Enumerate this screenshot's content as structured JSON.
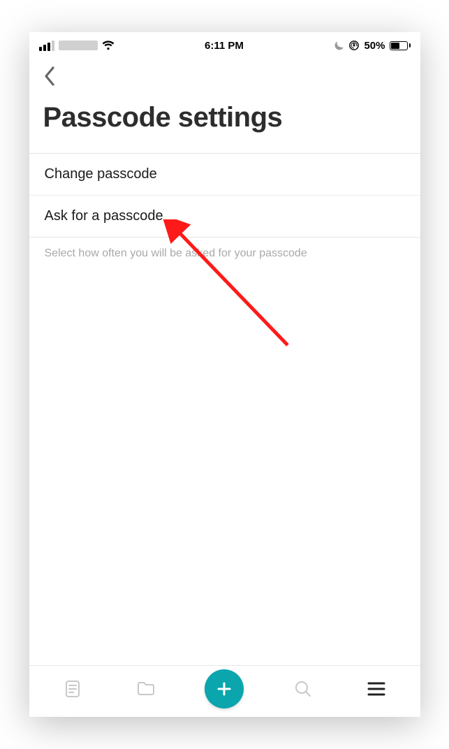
{
  "status_bar": {
    "time": "6:11 PM",
    "battery_percent": "50%"
  },
  "page": {
    "title": "Passcode settings"
  },
  "list": {
    "change_passcode": "Change passcode",
    "ask_for_passcode": "Ask for a passcode",
    "helper": "Select how often you will be asked for your passcode"
  }
}
